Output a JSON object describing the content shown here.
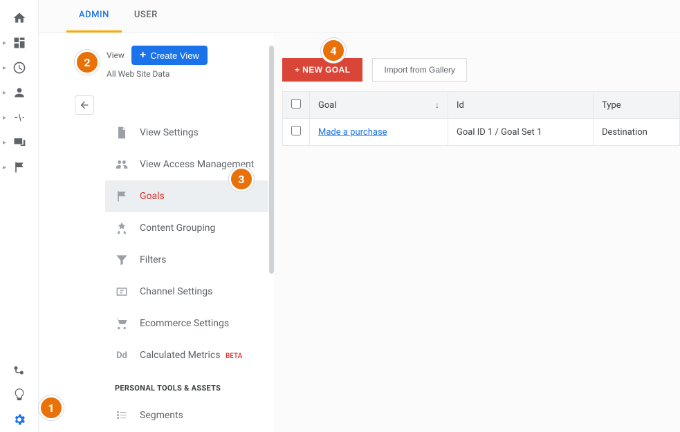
{
  "tabs": {
    "admin": "ADMIN",
    "user": "USER"
  },
  "view": {
    "label": "View",
    "create_button": "Create View",
    "subtitle": "All Web Site Data"
  },
  "menu": {
    "view_settings": "View Settings",
    "view_access": "View Access Management",
    "goals": "Goals",
    "content_grouping": "Content Grouping",
    "filters": "Filters",
    "channel_settings": "Channel Settings",
    "ecommerce_settings": "Ecommerce Settings",
    "calculated_metrics": "Calculated Metrics",
    "calculated_metrics_beta": "BETA",
    "section_personal": "PERSONAL TOOLS & ASSETS",
    "segments": "Segments"
  },
  "goals_panel": {
    "new_goal": "+ NEW GOAL",
    "import_gallery": "Import from Gallery",
    "columns": {
      "goal": "Goal",
      "id": "Id",
      "type": "Type"
    },
    "rows": [
      {
        "name": "Made a purchase",
        "id": "Goal ID 1 / Goal Set 1",
        "type": "Destination"
      }
    ]
  },
  "callouts": {
    "c1": "1",
    "c2": "2",
    "c3": "3",
    "c4": "4"
  }
}
